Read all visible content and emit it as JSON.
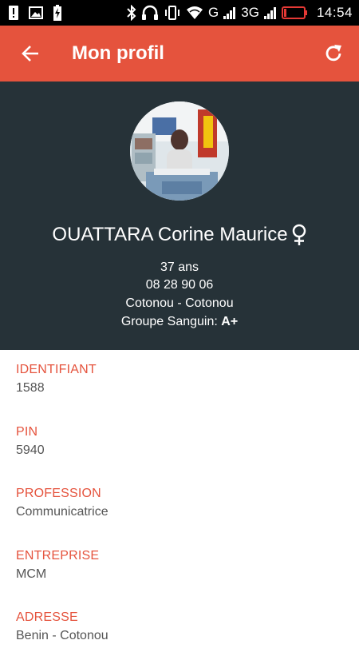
{
  "status_bar": {
    "time": "14:54",
    "network_1": "G",
    "network_2": "3G",
    "icons": [
      "alert-icon",
      "image-icon",
      "battery-charging-icon",
      "bluetooth-icon",
      "headphones-icon",
      "vibrate-icon",
      "wifi-icon",
      "signal-icon",
      "battery-low-icon"
    ],
    "battery_color": "#e53935"
  },
  "app_bar": {
    "title": "Mon profil",
    "background": "#e5533d"
  },
  "profile": {
    "name": "OUATTARA Corine Maurice",
    "gender_icon": "female-icon",
    "age": "37 ans",
    "phone": "08 28 90 06",
    "city": "Cotonou - Cotonou",
    "blood_label": "Groupe Sanguin:",
    "blood_value": "A+",
    "header_background": "#263238"
  },
  "fields": [
    {
      "label": "IDENTIFIANT",
      "value": "1588"
    },
    {
      "label": "PIN",
      "value": "5940"
    },
    {
      "label": "PROFESSION",
      "value": "Communicatrice"
    },
    {
      "label": "ENTREPRISE",
      "value": "MCM"
    },
    {
      "label": "ADRESSE",
      "value": "Benin - Cotonou"
    }
  ],
  "colors": {
    "accent": "#e5533d",
    "label": "#e5533d",
    "value": "#555555"
  }
}
